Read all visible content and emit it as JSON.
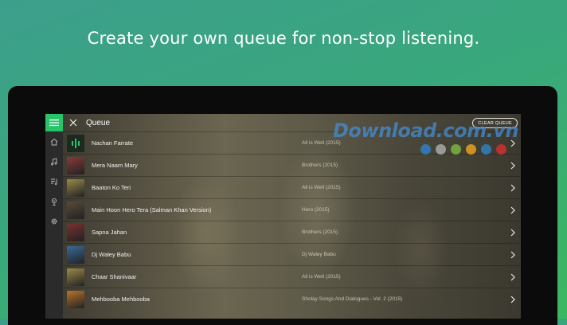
{
  "promo": {
    "headline": "Create your own queue for non-stop listening."
  },
  "header": {
    "title": "Queue",
    "clear_label": "CLEAR QUEUE"
  },
  "sidebar": {
    "icons": [
      "menu-icon",
      "home-icon",
      "music-note-icon",
      "playlist-icon",
      "radio-icon",
      "settings-icon"
    ]
  },
  "queue": [
    {
      "title": "Nachan Farrate",
      "album": "All is Well (2015)",
      "thumb": "#1d3a24"
    },
    {
      "title": "Mera Naam Mary",
      "album": "Brothers (2015)",
      "thumb": "#8a3a3a"
    },
    {
      "title": "Baaton Ko Teri",
      "album": "All is Well (2015)",
      "thumb": "#9a8a4a"
    },
    {
      "title": "Main Hoon Hero Tera (Salman Khan Version)",
      "album": "Hero (2015)",
      "thumb": "#5a4a3a"
    },
    {
      "title": "Sapna Jahan",
      "album": "Brothers (2015)",
      "thumb": "#7a3030"
    },
    {
      "title": "Dj Waley Babu",
      "album": "Dj Waley Babu",
      "thumb": "#3a6a9a"
    },
    {
      "title": "Chaar Shanivaar",
      "album": "All is Well (2015)",
      "thumb": "#9a8a4a"
    },
    {
      "title": "Mehbooba Mehbooba",
      "album": "Sholay Songs And Dialogues - Vol. 2 (2015)",
      "thumb": "#b8742a"
    }
  ],
  "watermark": {
    "text": "Download.com.vn",
    "dot_colors": [
      "#2f7fc0",
      "#a8a8a8",
      "#7cb342",
      "#e6a020",
      "#2f7fc0",
      "#d03030"
    ]
  },
  "colors": {
    "accent": "#27c46a",
    "rail": "#2b2b2b"
  }
}
